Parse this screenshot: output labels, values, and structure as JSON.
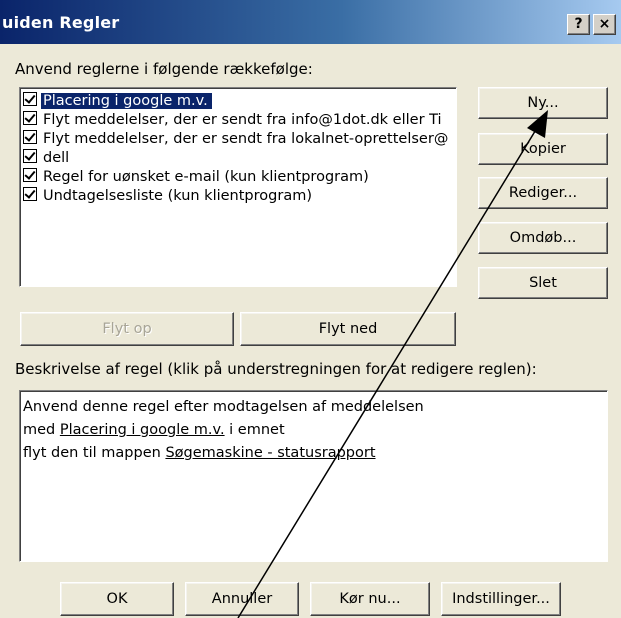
{
  "window": {
    "title": "uiden Regler",
    "help_label": "?",
    "close_label": "×"
  },
  "order_label": "Anvend reglerne i følgende rækkefølge:",
  "rules": [
    {
      "label": "Placering i google m.v.",
      "checked": true,
      "selected": true
    },
    {
      "label": "Flyt meddelelser, der er sendt fra info@1dot.dk eller Ti",
      "checked": true
    },
    {
      "label": "Flyt meddelelser, der er sendt fra lokalnet-oprettelser@",
      "checked": true
    },
    {
      "label": "dell",
      "checked": true
    },
    {
      "label": "Regel for uønsket e-mail  (kun klientprogram)",
      "checked": true
    },
    {
      "label": "Undtagelsesliste  (kun klientprogram)",
      "checked": true
    }
  ],
  "side_buttons": {
    "new": "Ny...",
    "copy": "Kopier",
    "edit": "Rediger...",
    "rename": "Omdøb...",
    "delete": "Slet"
  },
  "move_buttons": {
    "up": "Flyt op",
    "down": "Flyt ned"
  },
  "description_label": "Beskrivelse af regel (klik på understregningen for at redigere reglen):",
  "description": {
    "line1": "Anvend denne regel efter modtagelsen af meddelelsen",
    "line2_prefix": "med ",
    "line2_link": "Placering i google m.v.",
    "line2_suffix": " i emnet",
    "line3_prefix": "flyt den til mappen ",
    "line3_link": "Søgemaskine - statusrapport"
  },
  "bottom_buttons": {
    "ok": "OK",
    "cancel": "Annuller",
    "run_now": "Kør nu...",
    "options": "Indstillinger..."
  },
  "colors": {
    "titlebar_start": "#0a246a",
    "selection": "#0a246a",
    "face": "#ece9d8"
  }
}
